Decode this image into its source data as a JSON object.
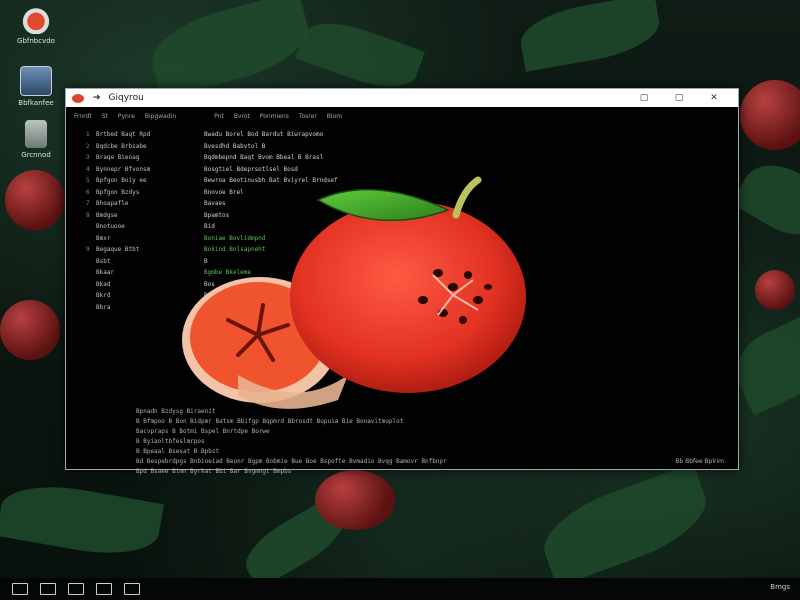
{
  "desktop": {
    "icons": [
      {
        "label": "Gbfnbcvdo"
      },
      {
        "label": "Bbfkanfee"
      },
      {
        "label": "Grcnnod"
      }
    ]
  },
  "window": {
    "title": "Giqyrou",
    "controls": {
      "minimize": "▢",
      "maximize": "▢",
      "close": "✕"
    }
  },
  "menubar": {
    "items": [
      "Frnrdt",
      "St",
      "Pynre",
      "Bipgwadin",
      "Pnt",
      "Bvrot",
      "Ponmiens",
      "Tosrer",
      "Blom"
    ]
  },
  "tree": {
    "rows": [
      {
        "num": "1",
        "text": "Brtbed Baqt Rpd"
      },
      {
        "num": "2",
        "text": "Bqdcbe Brbsabe"
      },
      {
        "num": "3",
        "text": "Braqe Bieoag"
      },
      {
        "num": "4",
        "text": "Bynnepr Bfvonsm"
      },
      {
        "num": "5",
        "text": "Bpfgon Boiy ee"
      },
      {
        "num": "6",
        "text": "Bpfgon Bzdys"
      },
      {
        "num": "7",
        "text": "Bhoapafle"
      },
      {
        "num": "8",
        "text": "Bmdgse"
      },
      {
        "num": "",
        "text": "Bnotuooe"
      },
      {
        "num": "",
        "text": "Bmxr"
      },
      {
        "num": "9",
        "text": "Begaque Btbt"
      },
      {
        "num": "",
        "text": "Bsbt"
      },
      {
        "num": "",
        "text": "Bkaar"
      },
      {
        "num": "",
        "text": "Bkad"
      },
      {
        "num": "",
        "text": "Bkrd"
      },
      {
        "num": "",
        "text": "Bbra"
      }
    ]
  },
  "list": {
    "rows": [
      {
        "text": "Bwadu Borel Bod Bardut Biwrapvomo",
        "green": false
      },
      {
        "text": "Bvesdhd Babvtol B",
        "green": false
      },
      {
        "text": "Bqdmbepnd Baqt Bvom Bbeal B Brasl",
        "green": false
      },
      {
        "text": "Bosgtiel Bdeprsotlsel Bosd",
        "green": false
      },
      {
        "text": "Bewroa Beotinusbh Bat Bviyrel Brndsef",
        "green": false
      },
      {
        "text": "Bnovoe Brel",
        "green": false
      },
      {
        "text": "Bavaes",
        "green": false
      },
      {
        "text": "Bpamtos",
        "green": false
      },
      {
        "text": "Bid",
        "green": false
      },
      {
        "text": "Boniae Bovlidmpnd",
        "green": true
      },
      {
        "text": "Bokind Bolsapneht",
        "green": true
      },
      {
        "text": "B",
        "green": false
      },
      {
        "text": "Bgmbe Bkeleme",
        "green": true
      },
      {
        "text": "Bos",
        "green": false
      },
      {
        "text": "Bd",
        "green": false
      }
    ]
  },
  "log": {
    "rows": [
      "Bpnadn Bzdysg Biraenit",
      "B Bfmpoo B Bon Bidpmr Batsm Bbifgp Bqpmrd Bbrosdt Bupuia Bie Bonavitmoplot",
      "Bacvpraps B Botmi Bspel Bnrtdpe Borwe",
      "B Byiaoltbfeslmrpos",
      "B Bpeaal Bsesat         B Bpbst",
      "Bd Bespebrdpgs Bnbioeiad Beonr Bgpm Bobmie Bue Boe Bspofte Bvmadio Bvqg Bamovr Bnfbnpr",
      "Bpd Bsaee Btmn Byrkat Bbi Bar Bvgmngt Bmpbs"
    ]
  },
  "status": {
    "text": "Bb  Bbfee  Bplrim"
  },
  "taskbar": {
    "items": [
      "start",
      "search",
      "task-view",
      "explorer",
      "app"
    ],
    "tray_text": "Bmgs"
  }
}
